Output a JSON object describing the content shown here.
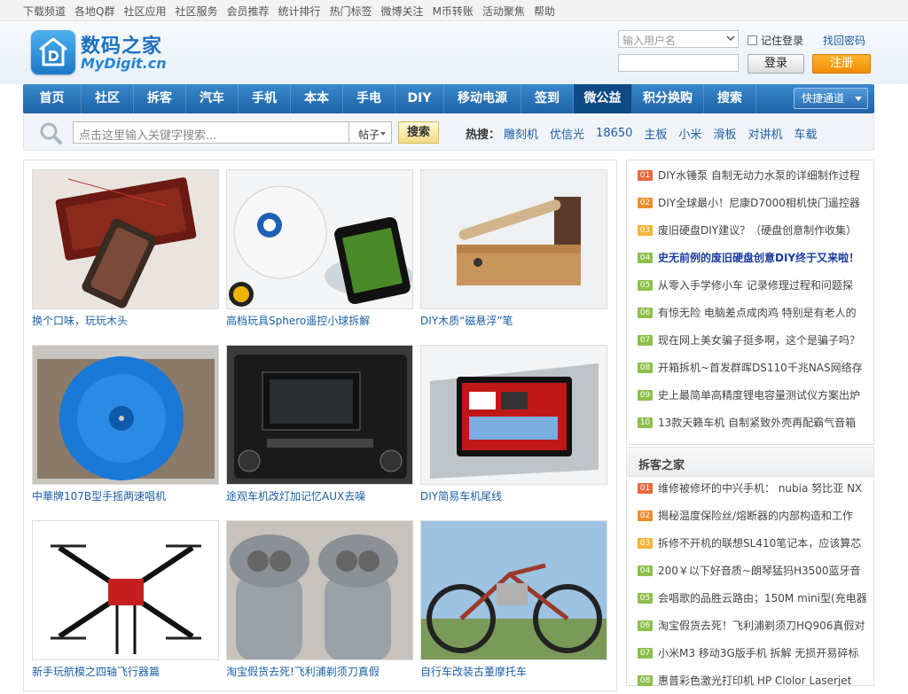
{
  "topnav": {
    "links": [
      "下载频道",
      "各地Q群",
      "社区应用",
      "社区服务",
      "会员推荐",
      "统计排行",
      "热门标签",
      "微博关注",
      "M币转账",
      "活动聚焦",
      "帮助"
    ]
  },
  "brand": {
    "name_cn": "数码之家",
    "name_en": "MyDigit.cn",
    "logo_icon": "house-d-icon",
    "color_primary": "#1e6fbf",
    "color_accent": "#f28b00"
  },
  "login": {
    "username_placeholder": "输入用户名",
    "remember_label": "记住登录",
    "find_password": "找回密码",
    "login_button": "登录",
    "register_button": "注册"
  },
  "mainnav": {
    "items": [
      "首页",
      "社区",
      "拆客",
      "汽车",
      "手机",
      "本本",
      "手电",
      "DIY",
      "移动电源",
      "签到",
      "微公益",
      "积分换购",
      "搜索"
    ],
    "active": "微公益",
    "quick_label": "快捷通道"
  },
  "search": {
    "placeholder": "点击这里输入关键字搜索...",
    "scope": "帖子",
    "button": "搜索",
    "hot_label": "热搜：",
    "hot_keywords": [
      "雕刻机",
      "优信光",
      "18650",
      "主板",
      "小米",
      "滑板",
      "对讲机",
      "车载"
    ]
  },
  "gallery": {
    "items": [
      {
        "caption": "换个口味，玩玩木头",
        "image": "wood-pendant-image"
      },
      {
        "caption": "高档玩具Sphero遥控小球拆解",
        "image": "sphero-ball-image"
      },
      {
        "caption": "DIY木质“磁悬浮”笔",
        "image": "wooden-pen-image"
      },
      {
        "caption": "中華牌107B型手摇两速唱机",
        "image": "turntable-image"
      },
      {
        "caption": "途观车机改灯加记忆AUX去噪",
        "image": "car-radio-image"
      },
      {
        "caption": "DIY简易车机尾线",
        "image": "car-head-unit-image"
      },
      {
        "caption": "新手玩航模之四轴飞行器篇",
        "image": "quadcopter-image"
      },
      {
        "caption": "淘宝假货去死!飞利浦剃须刀真假",
        "image": "shaver-image"
      },
      {
        "caption": "自行车改装古董摩托车",
        "image": "motorbike-image"
      }
    ]
  },
  "rank_list": {
    "items": [
      {
        "num": "01",
        "title": "DIY水锤泵 自制无动力水泵的详细制作过程",
        "highlight": false
      },
      {
        "num": "02",
        "title": "DIY全球最小！尼康D7000相机快门遥控器",
        "highlight": false
      },
      {
        "num": "03",
        "title": "废旧硬盘DIY建议？（硬盘创意制作收集）",
        "highlight": false
      },
      {
        "num": "04",
        "title": "史无前例的废旧硬盘创意DIY终于又来啦！",
        "highlight": true
      },
      {
        "num": "05",
        "title": "从零入手学修小车 记录修理过程和问题探",
        "highlight": false
      },
      {
        "num": "06",
        "title": "有惊无险 电脑差点成肉鸡 特别是有老人的",
        "highlight": false
      },
      {
        "num": "07",
        "title": "现在网上美女骗子挺多啊，这个是骗子吗？",
        "highlight": false
      },
      {
        "num": "08",
        "title": "开箱拆机~首发群晖DS110千兆NAS网络存",
        "highlight": false
      },
      {
        "num": "09",
        "title": "史上最简单高精度锂电容量测试仪方案出炉",
        "highlight": false
      },
      {
        "num": "10",
        "title": "13款天籁车机 自制紧致外壳再配霸气音箱",
        "highlight": false
      }
    ]
  },
  "chaike": {
    "title": "拆客之家",
    "items": [
      {
        "num": "01",
        "title": "维修被修坏的中兴手机： nubia 努比亚 NX"
      },
      {
        "num": "02",
        "title": "揭秘温度保险丝/熔断器的内部构造和工作"
      },
      {
        "num": "03",
        "title": "拆修不开机的联想SL410笔记本，应该算芯"
      },
      {
        "num": "04",
        "title": "200￥以下好音质~朗琴猛犸H3500蓝牙音"
      },
      {
        "num": "05",
        "title": "会唱歌的品胜云路由；150M mini型(充电器"
      },
      {
        "num": "06",
        "title": "淘宝假货去死！飞利浦剃须刀HQ906真假对"
      },
      {
        "num": "07",
        "title": "小米M3 移动3G版手机 拆解 无损开易碎标"
      },
      {
        "num": "08",
        "title": "惠普彩色激光打印机 HP Clolor Laserjet"
      }
    ]
  },
  "num_colors": [
    "#e8693c",
    "#f08c2a",
    "#f2b434",
    "#8cc04a",
    "#8cc04a",
    "#8cc04a",
    "#8cc04a",
    "#8cc04a",
    "#8cc04a",
    "#8cc04a"
  ]
}
